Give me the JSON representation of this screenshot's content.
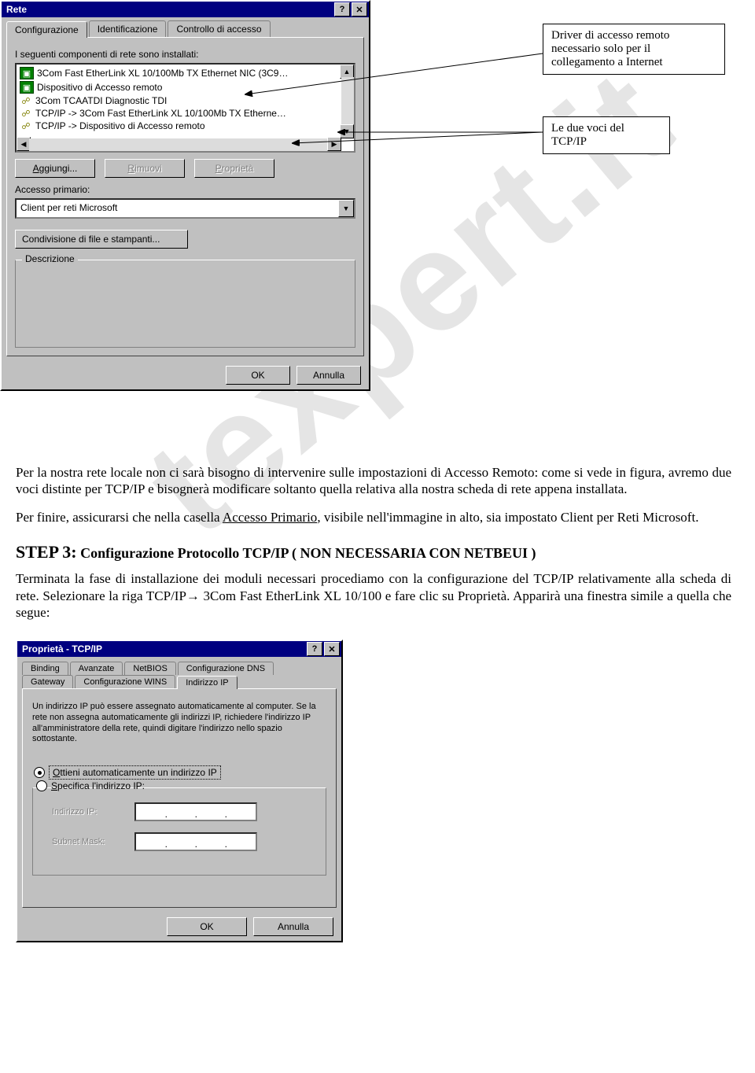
{
  "dialog1": {
    "title": "Rete",
    "help_btn": "?",
    "close_btn": "✕",
    "tabs": [
      "Configurazione",
      "Identificazione",
      "Controllo di accesso"
    ],
    "installed_label": "I seguenti componenti di rete sono installati:",
    "list_items": [
      "3Com Fast EtherLink XL 10/100Mb TX Ethernet NIC (3C9…",
      "Dispositivo di Accesso remoto",
      "3Com TCAATDI Diagnostic TDI",
      "TCP/IP -> 3Com Fast EtherLink XL 10/100Mb TX Etherne…",
      "TCP/IP -> Dispositivo di Accesso remoto"
    ],
    "add_btn": "Aggiungi...",
    "remove_btn": "Rimuovi",
    "props_btn": "Proprietà",
    "primary_label": "Accesso primario:",
    "primary_value": "Client per reti Microsoft",
    "share_btn": "Condivisione di file e stampanti...",
    "desc_label": "Descrizione",
    "ok_btn": "OK",
    "cancel_btn": "Annulla"
  },
  "callouts": {
    "driver": "Driver di accesso remoto necessario solo per il collegamento a  Internet",
    "tcpip": "Le due voci del TCP/IP"
  },
  "article": {
    "p1": "Per la nostra rete locale non ci sarà bisogno di intervenire sulle impostazioni di Accesso Remoto: come si vede in figura, avremo due voci distinte per TCP/IP e bisognerà modificare soltanto quella relativa alla nostra scheda di rete appena installata.",
    "p2a": "Per finire, assicurarsi che nella casella ",
    "p2_link": "Accesso Primario",
    "p2b": ", visibile nell'immagine in alto, sia impostato Client per Reti Microsoft.",
    "step_label": "STEP 3:",
    "step_title": " Configurazione Protocollo TCP/IP  ( NON NECESSARIA CON NETBEUI )",
    "p3": "Terminata la fase di installazione dei moduli necessari procediamo con la configurazione del TCP/IP relativamente alla scheda di rete. Selezionare la riga TCP/IP→ 3Com Fast EtherLink XL 10/100 e fare clic su Proprietà. Apparirà una finestra simile a quella che segue:"
  },
  "dialog2": {
    "title": "Proprietà - TCP/IP",
    "help_btn": "?",
    "close_btn": "✕",
    "tabs_row1": [
      "Binding",
      "Avanzate",
      "NetBIOS",
      "Configurazione DNS"
    ],
    "tabs_row2": [
      "Gateway",
      "Configurazione WINS",
      "Indirizzo IP"
    ],
    "info": "Un indirizzo IP può essere assegnato automaticamente al computer. Se la rete non assegna automaticamente gli indirizzi IP, richiedere l'indirizzo IP all'amministratore della rete, quindi digitare l'indirizzo nello spazio sottostante.",
    "radio_auto": "Ottieni automaticamente un indirizzo IP",
    "radio_spec": "Specifica l'indirizzo IP:",
    "ip_label": "Indirizzo IP:",
    "mask_label": "Subnet Mask:",
    "ok_btn": "OK",
    "cancel_btn": "Annulla"
  }
}
